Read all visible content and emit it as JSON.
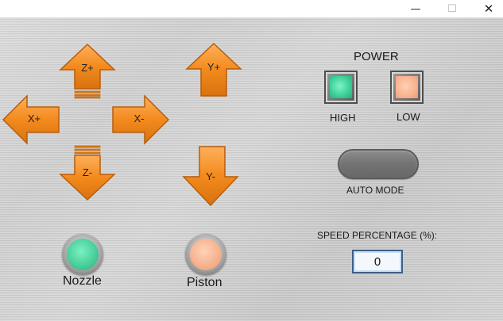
{
  "window": {
    "minimize_glyph": "—",
    "maximize_glyph": "☐",
    "close_glyph": "✕"
  },
  "jog": {
    "z_plus": "Z+",
    "z_minus": "Z-",
    "x_plus": "X+",
    "x_minus": "X-",
    "y_plus": "Y+",
    "y_minus": "Y-",
    "arrow_color": "#f28a1e",
    "arrow_dark": "#b85d0b"
  },
  "power": {
    "title": "POWER",
    "high_label": "HIGH",
    "low_label": "LOW",
    "high_color": "#3fd199",
    "low_color": "#f8b28f"
  },
  "auto_mode": {
    "label": "AUTO MODE"
  },
  "speed": {
    "label": "SPEED PERCENTAGE (%):",
    "value": "0"
  },
  "indicators": {
    "nozzle_label": "Nozzle",
    "piston_label": "Piston"
  }
}
